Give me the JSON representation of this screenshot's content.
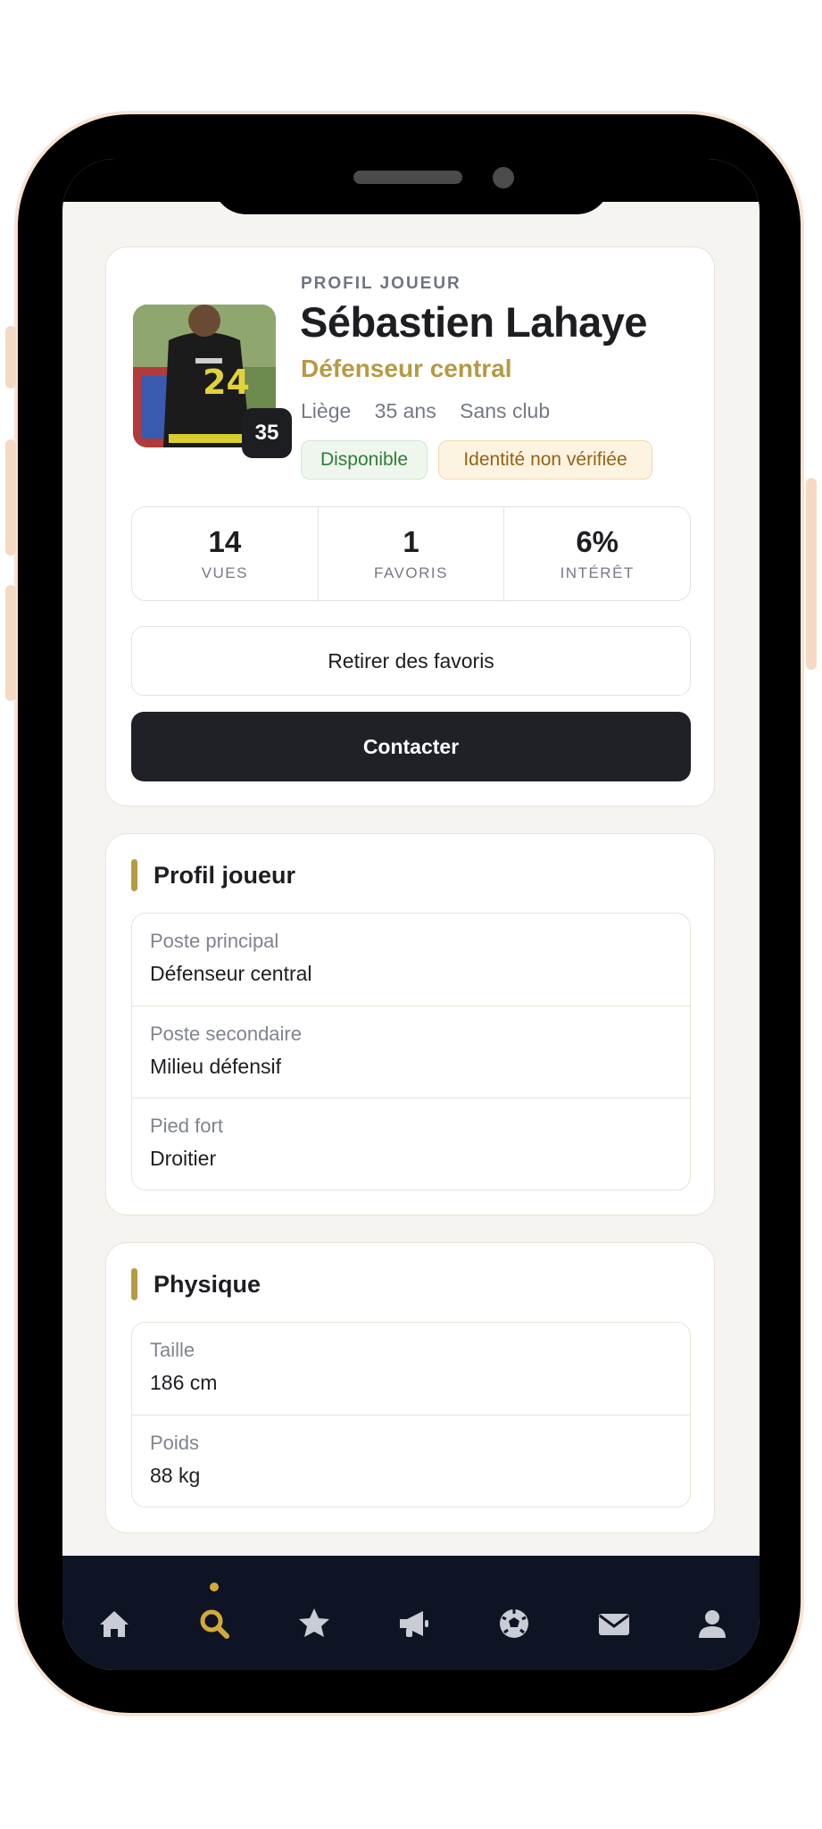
{
  "profile": {
    "eyebrow": "PROFIL JOUEUR",
    "name": "Sébastien Lahaye",
    "role": "Défenseur central",
    "city": "Liège",
    "age": "35 ans",
    "club": "Sans club",
    "number": "35",
    "jersey_number": "24",
    "tags": {
      "available": "Disponible",
      "identity": "Identité non vérifiée"
    }
  },
  "stats": [
    {
      "value": "14",
      "label": "VUES"
    },
    {
      "value": "1",
      "label": "FAVORIS"
    },
    {
      "value": "6%",
      "label": "INTÉRÊT"
    }
  ],
  "actions": {
    "favorite": "Retirer des favoris",
    "contact": "Contacter"
  },
  "profile_section": {
    "title": "Profil joueur",
    "rows": [
      {
        "label": "Poste principal",
        "value": "Défenseur central"
      },
      {
        "label": "Poste secondaire",
        "value": "Milieu défensif"
      },
      {
        "label": "Pied fort",
        "value": "Droitier"
      }
    ]
  },
  "physique_section": {
    "title": "Physique",
    "rows": [
      {
        "label": "Taille",
        "value": "186 cm"
      },
      {
        "label": "Poids",
        "value": "88 kg"
      }
    ]
  },
  "tabbar": {
    "active": "search",
    "items": [
      "home-icon",
      "search-icon",
      "star-icon",
      "megaphone-icon",
      "soccer-ball-icon",
      "envelope-icon",
      "user-icon"
    ]
  },
  "colors": {
    "accent": "#b69a43",
    "dark": "#1f2127",
    "tabbar": "#0f1424",
    "active_tab": "#d4a93c",
    "inactive_tab": "#c9ccd4"
  }
}
